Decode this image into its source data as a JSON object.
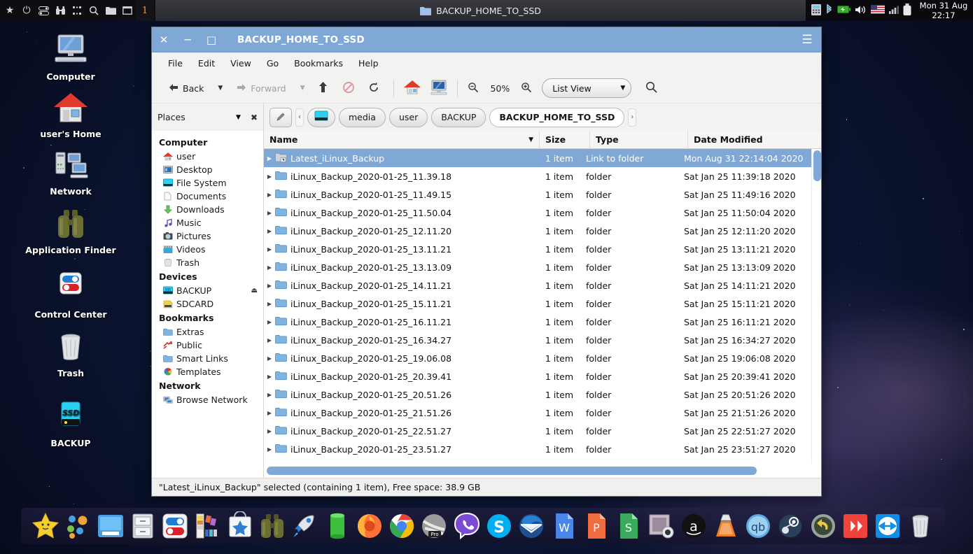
{
  "panel": {
    "left_icons": [
      "star-icon",
      "power-icon",
      "toggles-icon",
      "binoculars-icon",
      "apps-grid-icon",
      "search-icon",
      "folder-icon",
      "window-icon"
    ],
    "workspace_number": "1",
    "task_title": "BACKUP_HOME_TO_SSD",
    "tray_icons": [
      "calculator-icon",
      "bluetooth-icon",
      "battery-icon",
      "volume-icon",
      "us-flag-icon",
      "signal-icon",
      "usb-drive-icon"
    ],
    "clock_line1": "Mon 31 Aug",
    "clock_line2": "22:17"
  },
  "desktop": {
    "icons": [
      {
        "label": "Computer",
        "icon": "computer-icon"
      },
      {
        "label": "user's Home",
        "icon": "home-icon"
      },
      {
        "label": "Network",
        "icon": "network-icon"
      },
      {
        "label": "Application Finder",
        "icon": "binoculars-icon"
      },
      {
        "label": "Control Center",
        "icon": "control-center-icon"
      },
      {
        "label": "Trash",
        "icon": "trash-icon"
      },
      {
        "label": "BACKUP",
        "icon": "ssd-drive-icon"
      }
    ]
  },
  "window": {
    "title": "BACKUP_HOME_TO_SSD",
    "close_label": "✕",
    "minimize_label": "─",
    "maximize_label": "□",
    "menu_label": "☰",
    "menus": [
      "File",
      "Edit",
      "View",
      "Go",
      "Bookmarks",
      "Help"
    ],
    "toolbar": {
      "back_label": "Back",
      "forward_label": "Forward",
      "up_label": "⬆",
      "stop_label": "⛔",
      "reload_label": "↺",
      "home_label": "home-icon",
      "computer_label": "computer-icon",
      "zoom_out_label": "⊖",
      "zoom_level": "50%",
      "zoom_in_label": "⊕",
      "view_mode": "List View",
      "search_label": "⚲"
    },
    "places_header": {
      "title": "Places",
      "dropdown": "▼",
      "close": "✖"
    },
    "pathbar": {
      "edit_icon": "pencil-icon",
      "prev": "‹",
      "next": "›",
      "crumbs": [
        {
          "label": "",
          "icon": "filesystem-icon",
          "active": false
        },
        {
          "label": "media",
          "icon": "",
          "active": false
        },
        {
          "label": "user",
          "icon": "",
          "active": false
        },
        {
          "label": "BACKUP",
          "icon": "",
          "active": false
        },
        {
          "label": "BACKUP_HOME_TO_SSD",
          "icon": "",
          "active": true
        }
      ]
    },
    "sidebar": {
      "groups": [
        {
          "header": "Computer",
          "items": [
            {
              "label": "user",
              "icon": "home-icon"
            },
            {
              "label": "Desktop",
              "icon": "desktop-icon"
            },
            {
              "label": "File System",
              "icon": "filesystem-icon"
            },
            {
              "label": "Documents",
              "icon": "documents-icon"
            },
            {
              "label": "Downloads",
              "icon": "downloads-icon"
            },
            {
              "label": "Music",
              "icon": "music-icon"
            },
            {
              "label": "Pictures",
              "icon": "pictures-icon"
            },
            {
              "label": "Videos",
              "icon": "videos-icon"
            },
            {
              "label": "Trash",
              "icon": "trash-icon"
            }
          ]
        },
        {
          "header": "Devices",
          "items": [
            {
              "label": "BACKUP",
              "icon": "ssd-drive-icon",
              "eject": "⏏"
            },
            {
              "label": "SDCARD",
              "icon": "sdcard-icon"
            }
          ]
        },
        {
          "header": "Bookmarks",
          "items": [
            {
              "label": "Extras",
              "icon": "folder-icon"
            },
            {
              "label": "Public",
              "icon": "public-icon"
            },
            {
              "label": "Smart Links",
              "icon": "folder-icon"
            },
            {
              "label": "Templates",
              "icon": "templates-icon"
            }
          ]
        },
        {
          "header": "Network",
          "items": [
            {
              "label": "Browse Network",
              "icon": "network-browse-icon"
            }
          ]
        }
      ]
    },
    "columns": {
      "name": "Name",
      "size": "Size",
      "type": "Type",
      "date": "Date Modified",
      "sort_indicator": "▼"
    },
    "files": [
      {
        "name": "Latest_iLinux_Backup",
        "size": "1 item",
        "type": "Link to folder",
        "date": "Mon Aug 31 22:14:04 2020",
        "selected": true,
        "icon": "link-folder-icon"
      },
      {
        "name": "iLinux_Backup_2020-01-25_11.39.18",
        "size": "1 item",
        "type": "folder",
        "date": "Sat Jan 25 11:39:18 2020",
        "selected": false,
        "icon": "folder-icon"
      },
      {
        "name": "iLinux_Backup_2020-01-25_11.49.15",
        "size": "1 item",
        "type": "folder",
        "date": "Sat Jan 25 11:49:16 2020",
        "selected": false,
        "icon": "folder-icon"
      },
      {
        "name": "iLinux_Backup_2020-01-25_11.50.04",
        "size": "1 item",
        "type": "folder",
        "date": "Sat Jan 25 11:50:04 2020",
        "selected": false,
        "icon": "folder-icon"
      },
      {
        "name": "iLinux_Backup_2020-01-25_12.11.20",
        "size": "1 item",
        "type": "folder",
        "date": "Sat Jan 25 12:11:20 2020",
        "selected": false,
        "icon": "folder-icon"
      },
      {
        "name": "iLinux_Backup_2020-01-25_13.11.21",
        "size": "1 item",
        "type": "folder",
        "date": "Sat Jan 25 13:11:21 2020",
        "selected": false,
        "icon": "folder-icon"
      },
      {
        "name": "iLinux_Backup_2020-01-25_13.13.09",
        "size": "1 item",
        "type": "folder",
        "date": "Sat Jan 25 13:13:09 2020",
        "selected": false,
        "icon": "folder-icon"
      },
      {
        "name": "iLinux_Backup_2020-01-25_14.11.21",
        "size": "1 item",
        "type": "folder",
        "date": "Sat Jan 25 14:11:21 2020",
        "selected": false,
        "icon": "folder-icon"
      },
      {
        "name": "iLinux_Backup_2020-01-25_15.11.21",
        "size": "1 item",
        "type": "folder",
        "date": "Sat Jan 25 15:11:21 2020",
        "selected": false,
        "icon": "folder-icon"
      },
      {
        "name": "iLinux_Backup_2020-01-25_16.11.21",
        "size": "1 item",
        "type": "folder",
        "date": "Sat Jan 25 16:11:21 2020",
        "selected": false,
        "icon": "folder-icon"
      },
      {
        "name": "iLinux_Backup_2020-01-25_16.34.27",
        "size": "1 item",
        "type": "folder",
        "date": "Sat Jan 25 16:34:27 2020",
        "selected": false,
        "icon": "folder-icon"
      },
      {
        "name": "iLinux_Backup_2020-01-25_19.06.08",
        "size": "1 item",
        "type": "folder",
        "date": "Sat Jan 25 19:06:08 2020",
        "selected": false,
        "icon": "folder-icon"
      },
      {
        "name": "iLinux_Backup_2020-01-25_20.39.41",
        "size": "1 item",
        "type": "folder",
        "date": "Sat Jan 25 20:39:41 2020",
        "selected": false,
        "icon": "folder-icon"
      },
      {
        "name": "iLinux_Backup_2020-01-25_20.51.26",
        "size": "1 item",
        "type": "folder",
        "date": "Sat Jan 25 20:51:26 2020",
        "selected": false,
        "icon": "folder-icon"
      },
      {
        "name": "iLinux_Backup_2020-01-25_21.51.26",
        "size": "1 item",
        "type": "folder",
        "date": "Sat Jan 25 21:51:26 2020",
        "selected": false,
        "icon": "folder-icon"
      },
      {
        "name": "iLinux_Backup_2020-01-25_22.51.27",
        "size": "1 item",
        "type": "folder",
        "date": "Sat Jan 25 22:51:27 2020",
        "selected": false,
        "icon": "folder-icon"
      },
      {
        "name": "iLinux_Backup_2020-01-25_23.51.27",
        "size": "1 item",
        "type": "folder",
        "date": "Sat Jan 25 23:51:27 2020",
        "selected": false,
        "icon": "folder-icon"
      }
    ],
    "status": "\"Latest_iLinux_Backup\" selected (containing 1 item), Free space: 38.9 GB"
  },
  "dock": {
    "items": [
      "star-launcher-icon",
      "dots-app-icon",
      "window-manager-icon",
      "file-cabinet-icon",
      "control-center-icon",
      "color-palette-icon",
      "app-store-icon",
      "binoculars-icon",
      "rocket-icon",
      "green-drum-icon",
      "firefox-icon",
      "chrome-icon",
      "opera-pro-icon",
      "viber-icon",
      "skype-icon",
      "thunderbird-icon",
      "word-icon",
      "powerpoint-icon",
      "sheets-icon",
      "scanner-icon",
      "amazon-icon",
      "vlc-icon",
      "qbittorrent-icon",
      "steam-icon",
      "undo-icon",
      "anydesk-icon",
      "teamviewer-icon",
      "trash-icon"
    ]
  },
  "colors": {
    "accent": "#7fa8d6",
    "titlebar": "#7fa8d6",
    "panel": "#1b1b20",
    "window_bg": "#f0f0ef"
  }
}
